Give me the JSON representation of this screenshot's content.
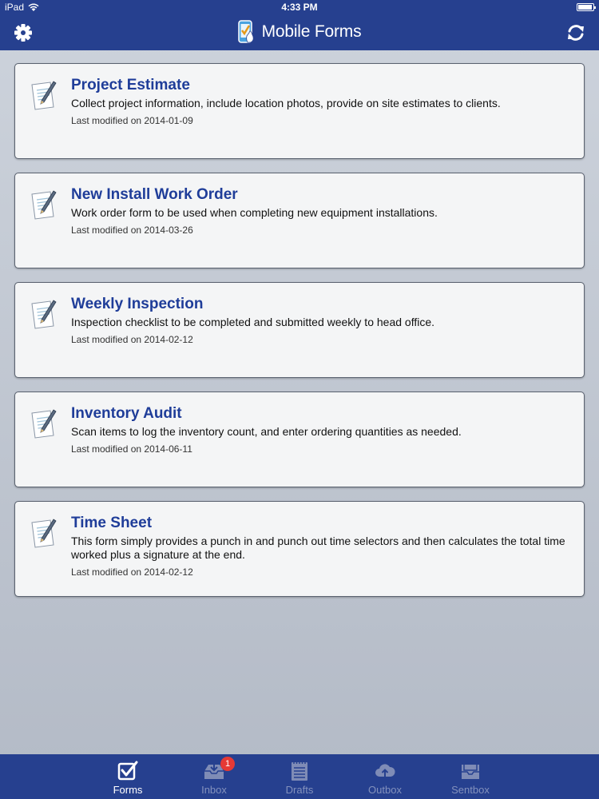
{
  "status_bar": {
    "device": "iPad",
    "time": "4:33 PM"
  },
  "nav_bar": {
    "title": "Mobile Forms",
    "left_icon": "gear-icon",
    "right_icon": "refresh-icon"
  },
  "colors": {
    "nav_background": "#26408f",
    "title_blue": "#1f3d99",
    "page_background": "#c4cad4",
    "badge_red": "#e53935"
  },
  "forms": [
    {
      "title": "Project Estimate",
      "description": "Collect project information, include location photos, provide on site estimates to clients.",
      "modified": "Last modified on 2014-01-09"
    },
    {
      "title": "New Install Work Order",
      "description": "Work order form to be used when completing new equipment installations.",
      "modified": "Last modified on 2014-03-26"
    },
    {
      "title": "Weekly Inspection",
      "description": "Inspection checklist to be completed and submitted weekly to head office.",
      "modified": "Last modified on 2014-02-12"
    },
    {
      "title": "Inventory Audit",
      "description": "Scan items to log the inventory count, and enter ordering quantities as needed.",
      "modified": "Last modified on 2014-06-11"
    },
    {
      "title": "Time Sheet",
      "description": "This form simply provides a punch in and punch out time selectors and then calculates the total time worked plus a signature at the end.",
      "modified": "Last modified on 2014-02-12"
    }
  ],
  "tab_bar": {
    "tabs": [
      {
        "label": "Forms",
        "icon": "checkbox-icon",
        "active": true
      },
      {
        "label": "Inbox",
        "icon": "inbox-icon",
        "badge": "1"
      },
      {
        "label": "Drafts",
        "icon": "drafts-icon"
      },
      {
        "label": "Outbox",
        "icon": "cloud-upload-icon"
      },
      {
        "label": "Sentbox",
        "icon": "sentbox-icon"
      }
    ]
  }
}
